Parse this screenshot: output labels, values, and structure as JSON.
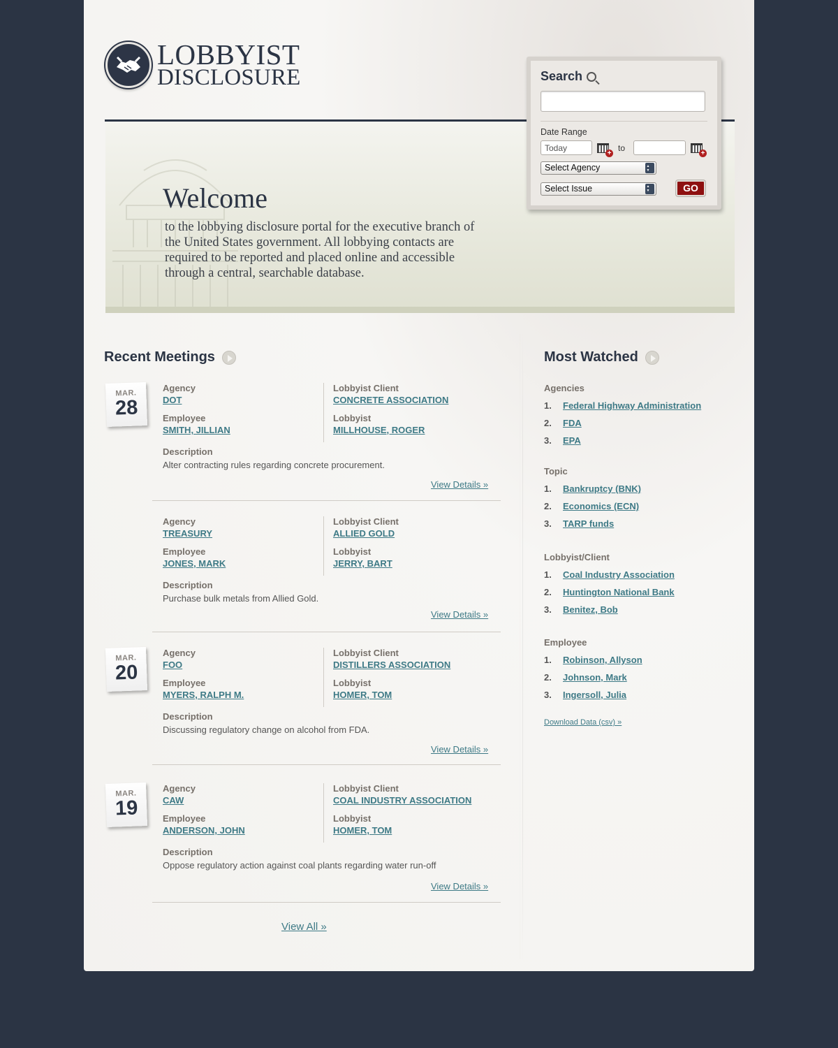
{
  "logo": {
    "line1": "LOBBYIST",
    "line2": "DISCLOSURE",
    "icon": "handshake-icon"
  },
  "hero": {
    "title": "Welcome",
    "text": "to the lobbying disclosure portal for the executive branch of the United States government. All lobbying contacts are required to be reported and placed online and accessible through a central, searchable database."
  },
  "search": {
    "title": "Search",
    "query_value": "",
    "date_range_label": "Date Range",
    "date_from": "Today",
    "date_to_label": "to",
    "date_to": "",
    "agency_select": "Select Agency",
    "issue_select": "Select Issue",
    "go_label": "GO"
  },
  "recent": {
    "title": "Recent Meetings",
    "labels": {
      "agency": "Agency",
      "employee": "Employee",
      "client": "Lobbyist Client",
      "lobbyist": "Lobbyist",
      "description": "Description",
      "view_details": "View Details »"
    },
    "meetings": [
      {
        "month": "MAR.",
        "day": "28",
        "agency": "DOT",
        "employee": "SMITH, JILLIAN",
        "client": "CONCRETE ASSOCIATION",
        "lobbyist": "MILLHOUSE, ROGER",
        "description": "Alter contracting rules regarding concrete procurement."
      },
      {
        "month": "",
        "day": "",
        "agency": "TREASURY",
        "employee": "JONES, MARK",
        "client": "ALLIED GOLD",
        "lobbyist": "JERRY, BART",
        "description": "Purchase bulk metals from Allied Gold."
      },
      {
        "month": "MAR.",
        "day": "20",
        "agency": "FOO",
        "employee": "MYERS, RALPH M.",
        "client": "DISTILLERS ASSOCIATION",
        "lobbyist": "HOMER, TOM",
        "description": "Discussing regulatory change on alcohol from FDA."
      },
      {
        "month": "MAR.",
        "day": "19",
        "agency": "CAW",
        "employee": "ANDERSON, JOHN",
        "client": "COAL INDUSTRY ASSOCIATION",
        "lobbyist": "HOMER, TOM",
        "description": "Oppose regulatory action against coal plants regarding water run-off"
      }
    ],
    "view_all": "View All »"
  },
  "watched": {
    "title": "Most Watched",
    "groups": [
      {
        "label": "Agencies",
        "items": [
          "Federal Highway Administration",
          "FDA",
          "EPA"
        ]
      },
      {
        "label": "Topic",
        "items": [
          "Bankruptcy (BNK)",
          "Economics (ECN)",
          "TARP funds"
        ]
      },
      {
        "label": "Lobbyist/Client",
        "items": [
          "Coal Industry Association",
          "Huntington National Bank",
          "Benitez, Bob"
        ]
      },
      {
        "label": "Employee",
        "items": [
          "Robinson, Allyson",
          "Johnson, Mark",
          "Ingersoll, Julia"
        ]
      }
    ],
    "numbers": [
      "1.",
      "2.",
      "3."
    ],
    "download": "Download Data (csv) »"
  }
}
